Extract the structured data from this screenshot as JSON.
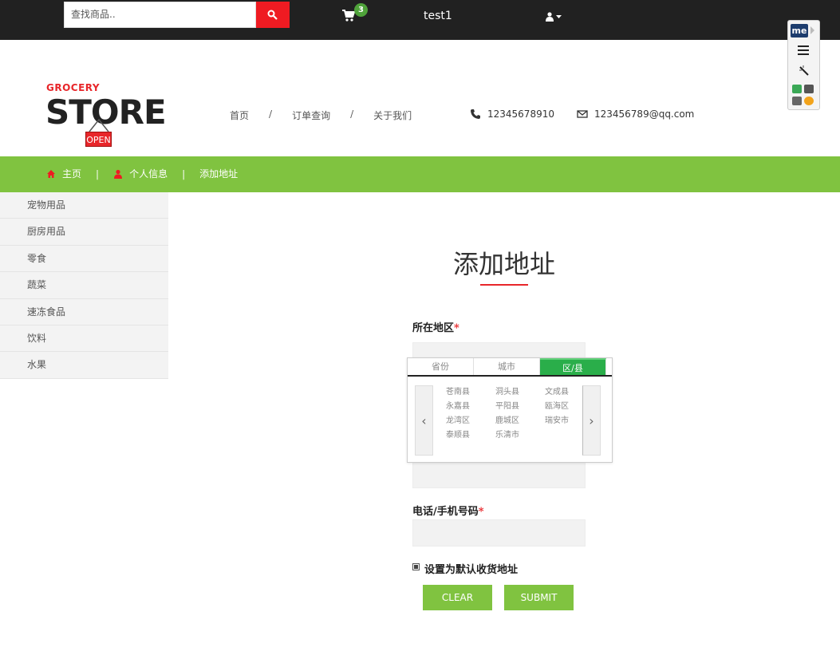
{
  "topbar": {
    "search_placeholder": "查找商品..",
    "cart_count": "3",
    "username": "test1"
  },
  "header": {
    "logo_top": "GROCERY",
    "logo_main": "STORE",
    "logo_sign": "OPEN",
    "nav": [
      {
        "label": "首页"
      },
      {
        "label": "订单查询"
      },
      {
        "label": "关于我们"
      }
    ],
    "nav_separator": "/",
    "phone": "12345678910",
    "email": "123456789@qq.com"
  },
  "breadcrumb": {
    "home": "主页",
    "profile": "个人信息",
    "current": "添加地址",
    "separator": "|"
  },
  "sidebar": {
    "items": [
      {
        "label": "宠物用品"
      },
      {
        "label": "厨房用品"
      },
      {
        "label": "零食"
      },
      {
        "label": "蔬菜"
      },
      {
        "label": "速冻食品"
      },
      {
        "label": "饮料"
      },
      {
        "label": "水果"
      }
    ]
  },
  "form": {
    "title": "添加地址",
    "region_label": "所在地区",
    "phone_label": "电话/手机号码",
    "required_mark": "*",
    "default_label": "设置为默认收货地址",
    "default_checked": true,
    "clear_label": "CLEAR",
    "submit_label": "SUBMIT"
  },
  "picker": {
    "tabs": [
      {
        "label": "省份",
        "active": false
      },
      {
        "label": "城市",
        "active": false
      },
      {
        "label": "区/县",
        "active": true
      }
    ],
    "options": [
      "苍南县",
      "洞头县",
      "文成县",
      "永嘉县",
      "平阳县",
      "瓯海区",
      "龙湾区",
      "鹿城区",
      "瑞安市",
      "泰顺县",
      "乐清市"
    ],
    "prev": "‹",
    "next": "›"
  },
  "extension": {
    "badge": "me"
  },
  "colors": {
    "topbar": "#212121",
    "accent_red": "#ef1b22",
    "green": "#80c340",
    "active_tab": "#2aae4a"
  }
}
